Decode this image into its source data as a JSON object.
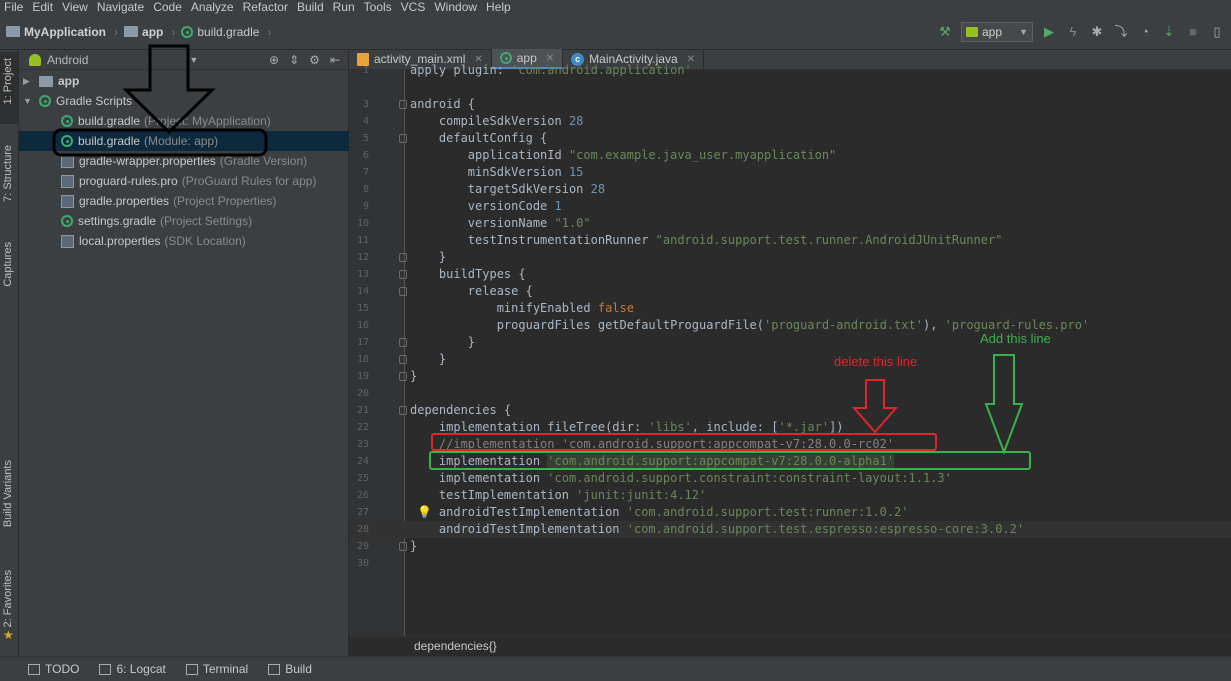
{
  "menu": [
    "File",
    "Edit",
    "View",
    "Navigate",
    "Code",
    "Analyze",
    "Refactor",
    "Build",
    "Run",
    "Tools",
    "VCS",
    "Window",
    "Help"
  ],
  "navbar": {
    "project": "MyApplication",
    "module": "app",
    "file": "build.gradle",
    "run_config": "app"
  },
  "left_tabs": {
    "project": "1: Project",
    "structure": "7: Structure",
    "captures": "Captures",
    "build_variants": "Build Variants",
    "favorites": "2: Favorites"
  },
  "project_panel": {
    "view": "Android",
    "tree": [
      {
        "label": "app",
        "detail": "",
        "level": 0,
        "type": "folder",
        "expanded": false
      },
      {
        "label": "Gradle Scripts",
        "detail": "",
        "level": 0,
        "type": "gradle",
        "expanded": true
      },
      {
        "label": "build.gradle",
        "detail": "(Project: MyApplication)",
        "level": 1,
        "type": "gradle"
      },
      {
        "label": "build.gradle",
        "detail": "(Module: app)",
        "level": 1,
        "type": "gradle",
        "selected": true
      },
      {
        "label": "gradle-wrapper.properties",
        "detail": "(Gradle Version)",
        "level": 1,
        "type": "props"
      },
      {
        "label": "proguard-rules.pro",
        "detail": "(ProGuard Rules for app)",
        "level": 1,
        "type": "props"
      },
      {
        "label": "gradle.properties",
        "detail": "(Project Properties)",
        "level": 1,
        "type": "props"
      },
      {
        "label": "settings.gradle",
        "detail": "(Project Settings)",
        "level": 1,
        "type": "gradle"
      },
      {
        "label": "local.properties",
        "detail": "(SDK Location)",
        "level": 1,
        "type": "props"
      }
    ]
  },
  "editor": {
    "tabs": [
      {
        "label": "activity_main.xml",
        "icon": "xml-icon"
      },
      {
        "label": "app",
        "icon": "gradle-icon",
        "active": true
      },
      {
        "label": "MainActivity.java",
        "icon": "class-icon"
      }
    ],
    "lines": [
      {
        "n": "1",
        "t": "apply plugin: 'com.android.application'"
      },
      {
        "n": "3",
        "t": "android {"
      },
      {
        "n": "4",
        "t": "    compileSdkVersion 28"
      },
      {
        "n": "5",
        "t": "    defaultConfig {"
      },
      {
        "n": "6",
        "t": "        applicationId \"com.example.java_user.myapplication\""
      },
      {
        "n": "7",
        "t": "        minSdkVersion 15"
      },
      {
        "n": "8",
        "t": "        targetSdkVersion 28"
      },
      {
        "n": "9",
        "t": "        versionCode 1"
      },
      {
        "n": "10",
        "t": "        versionName \"1.0\""
      },
      {
        "n": "11",
        "t": "        testInstrumentationRunner \"android.support.test.runner.AndroidJUnitRunner\""
      },
      {
        "n": "12",
        "t": "    }"
      },
      {
        "n": "13",
        "t": "    buildTypes {"
      },
      {
        "n": "14",
        "t": "        release {"
      },
      {
        "n": "15",
        "t": "            minifyEnabled false"
      },
      {
        "n": "16",
        "t": "            proguardFiles getDefaultProguardFile('proguard-android.txt'), 'proguard-rules.pro'"
      },
      {
        "n": "17",
        "t": "        }"
      },
      {
        "n": "18",
        "t": "    }"
      },
      {
        "n": "19",
        "t": "}"
      },
      {
        "n": "20",
        "t": ""
      },
      {
        "n": "21",
        "t": "dependencies {"
      },
      {
        "n": "22",
        "t": "    implementation fileTree(dir: 'libs', include: ['*.jar'])"
      },
      {
        "n": "23",
        "t": "    //implementation 'com.android.support:appcompat-v7:28.0.0-rc02'"
      },
      {
        "n": "24",
        "t": "    implementation 'com.android.support:appcompat-v7:28.0.0-alpha1'"
      },
      {
        "n": "25",
        "t": "    implementation 'com.android.support.constraint:constraint-layout:1.1.3'"
      },
      {
        "n": "26",
        "t": "    testImplementation 'junit:junit:4.12'"
      },
      {
        "n": "27",
        "t": "    androidTestImplementation 'com.android.support.test:runner:1.0.2'"
      },
      {
        "n": "28",
        "t": "    androidTestImplementation 'com.android.support.test.espresso:espresso-core:3.0.2'"
      },
      {
        "n": "29",
        "t": "}"
      },
      {
        "n": "30",
        "t": ""
      }
    ],
    "breadcrumb": "dependencies{}"
  },
  "bottom_bar": [
    {
      "label": "TODO",
      "icon": "todo-icon"
    },
    {
      "label": "6: Logcat",
      "icon": "logcat-icon"
    },
    {
      "label": "Terminal",
      "icon": "terminal-icon"
    },
    {
      "label": "Build",
      "icon": "build-icon"
    }
  ],
  "annotations": {
    "delete": "delete this line",
    "add": "Add this line"
  },
  "colors": {
    "annotation_red": "#e0262c",
    "annotation_green": "#36b34a",
    "gradle_green": "#3fa96f",
    "selection": "#0d293e"
  }
}
